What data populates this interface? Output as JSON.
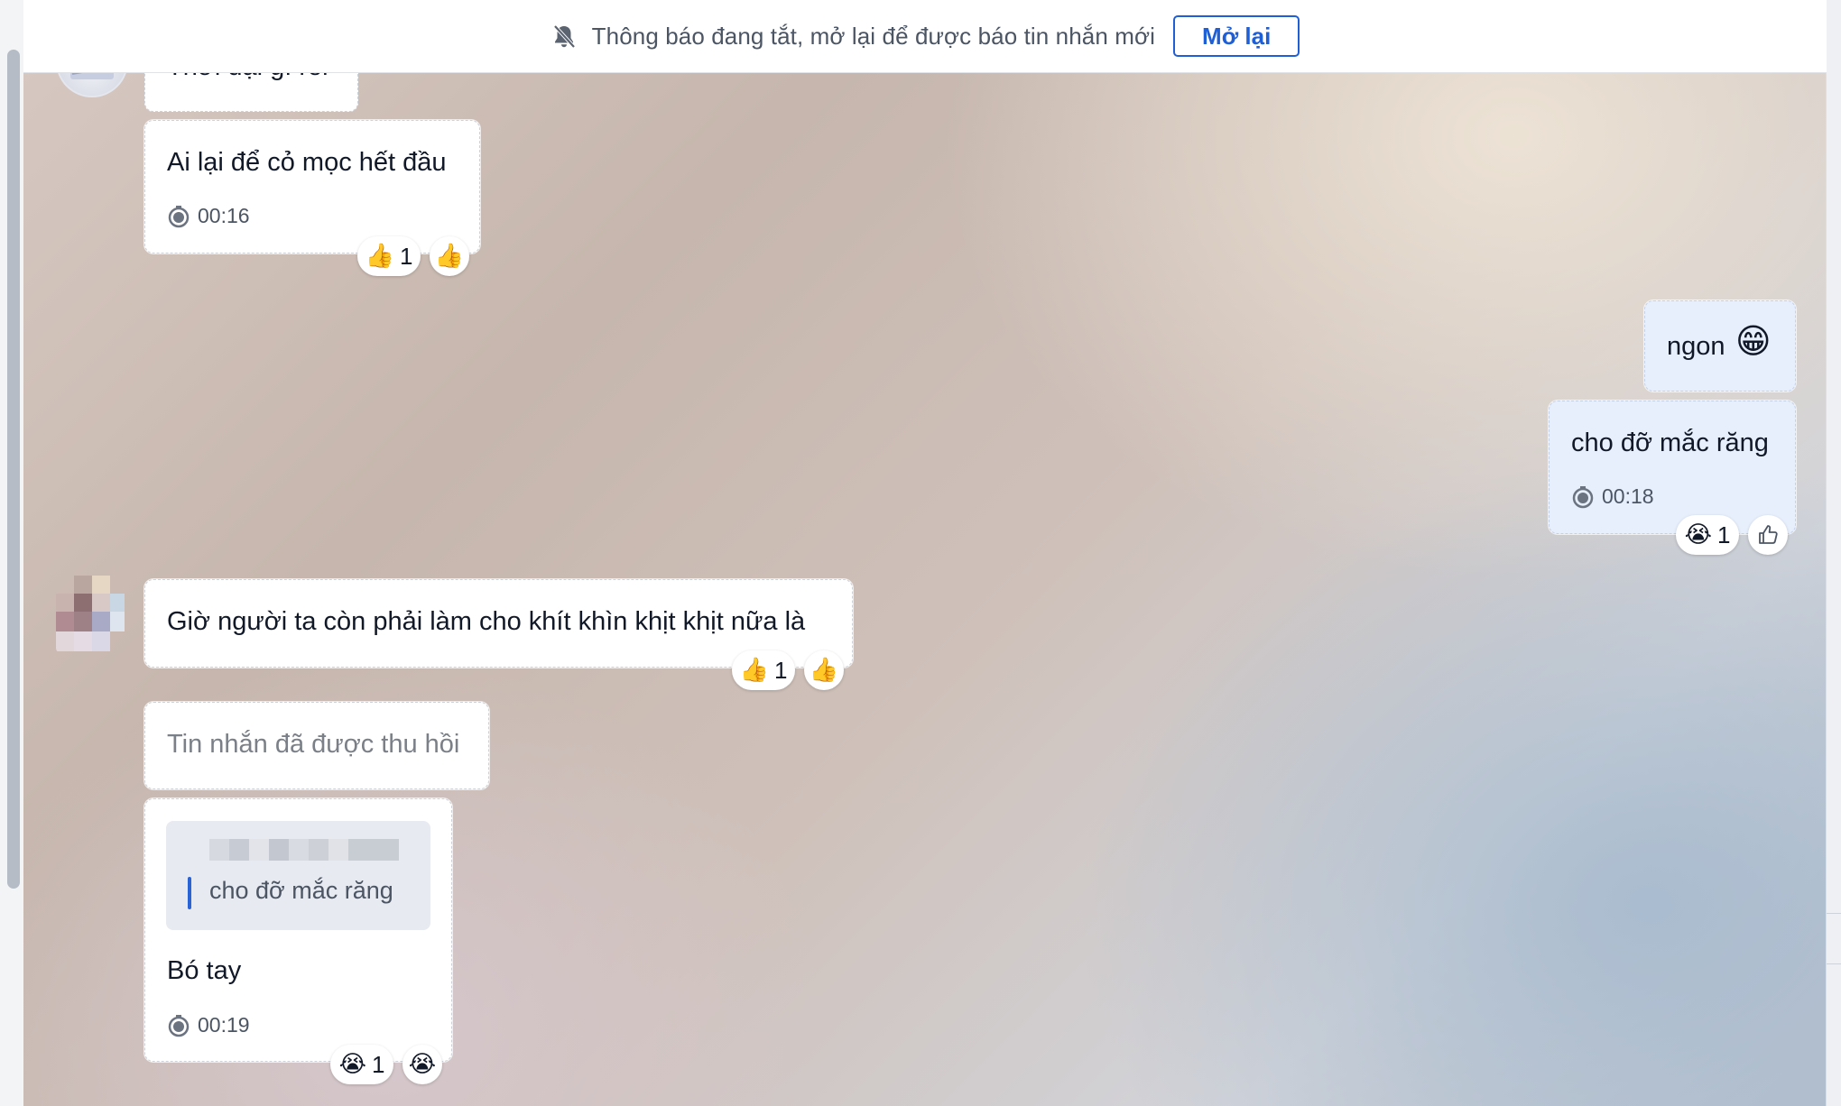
{
  "notification": {
    "text": "Thông báo đang tắt, mở lại để được báo tin nhắn mới",
    "button_label": "Mở lại"
  },
  "messages": [
    {
      "id": "partial",
      "text": "Thời đại gì rồi",
      "side": "left"
    },
    {
      "id": "m1",
      "text": "Ai lại để cỏ mọc hết đầu",
      "time": "00:16",
      "side": "left",
      "reaction": {
        "emoji": "👍",
        "count": "1"
      },
      "quick_reaction": "👍"
    },
    {
      "id": "m2",
      "text": "ngon",
      "emoji": "😁",
      "side": "right"
    },
    {
      "id": "m3",
      "text": "cho đỡ mắc răng",
      "time": "00:18",
      "side": "right",
      "reaction": {
        "emoji": "😭",
        "count": "1"
      },
      "quick_reaction": "like-outline-icon"
    },
    {
      "id": "m4",
      "text": "Giờ người ta còn phải làm cho khít khìn khịt khịt nữa là",
      "side": "left",
      "reaction": {
        "emoji": "👍",
        "count": "1"
      },
      "quick_reaction": "👍"
    },
    {
      "id": "m5",
      "text": "Tin nhắn đã được thu hồi",
      "side": "left",
      "recalled": true
    },
    {
      "id": "m6",
      "quote": "cho đỡ mắc răng",
      "text": "Bó tay",
      "time": "00:19",
      "side": "left",
      "reaction": {
        "emoji": "😭",
        "count": "1"
      },
      "quick_reaction": "😭"
    }
  ],
  "colors": {
    "accent": "#1f5fd6",
    "my_bubble": "#e7effd",
    "their_bubble": "#ffffff"
  }
}
